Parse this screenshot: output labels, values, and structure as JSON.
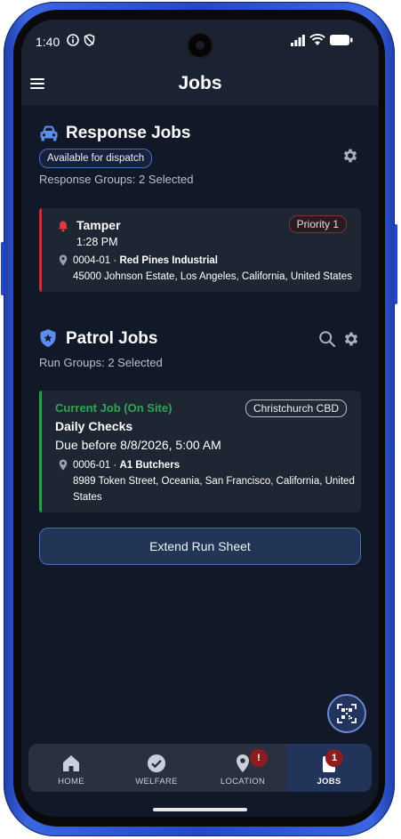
{
  "status_bar": {
    "time": "1:40"
  },
  "app_bar": {
    "title": "Jobs"
  },
  "response": {
    "title": "Response Jobs",
    "status_chip": "Available for dispatch",
    "groups_text": "Response Groups: 2 Selected",
    "job": {
      "name": "Tamper",
      "priority": "Priority 1",
      "time": "1:28 PM",
      "site_code": "0004-01 · ",
      "site_name": "Red Pines Industrial",
      "address": "45000 Johnson Estate, Los Angeles, California, United States"
    }
  },
  "patrol": {
    "title": "Patrol Jobs",
    "groups_text": "Run Groups: 2 Selected",
    "job": {
      "status": "Current Job (On Site)",
      "area": "Christchurch CBD",
      "name": "Daily Checks",
      "due": "Due before 8/8/2026, 5:00 AM",
      "site_code": "0006-01 · ",
      "site_name": "A1 Butchers",
      "address_line1": "8989 Token Street, Oceania, San Francisco, California, United",
      "address_line2": "States"
    },
    "extend_button": "Extend Run Sheet"
  },
  "nav": {
    "items": [
      {
        "label": "HOME",
        "icon": "home-icon"
      },
      {
        "label": "WELFARE",
        "icon": "check-circle-icon"
      },
      {
        "label": "LOCATION",
        "icon": "location-pin-icon",
        "badge": "!"
      },
      {
        "label": "JOBS",
        "icon": "clipboard-icon",
        "badge": "1",
        "active": true
      }
    ]
  },
  "colors": {
    "background": "#111827",
    "accent": "#4a7de0",
    "response_bar": "#c0313b",
    "patrol_bar": "#2e9a4f",
    "current_job_text": "#2fa653",
    "badge": "#8f1b1f"
  }
}
